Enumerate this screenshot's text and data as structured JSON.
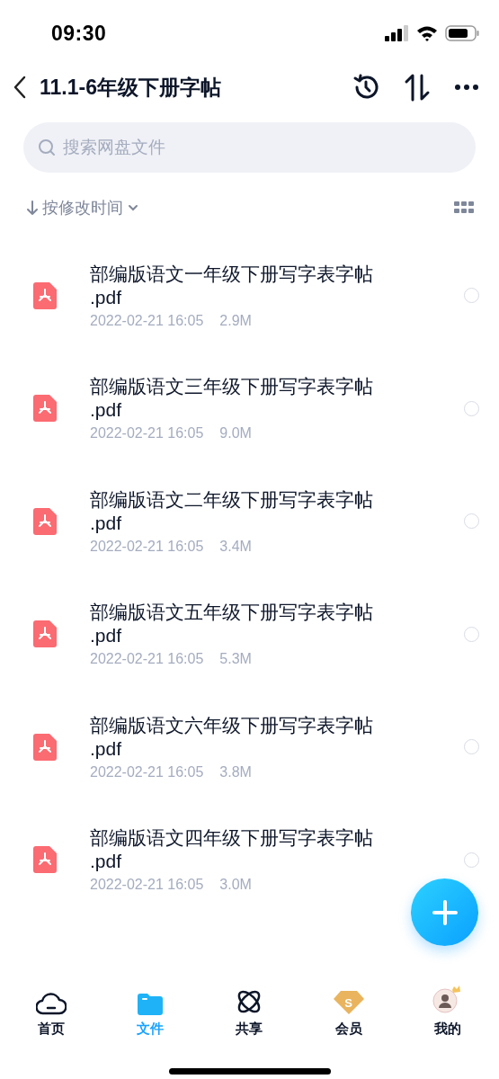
{
  "status_bar": {
    "time": "09:30"
  },
  "header": {
    "title": "11.1-6年级下册字帖"
  },
  "search": {
    "placeholder": "搜索网盘文件"
  },
  "sort": {
    "label": "按修改时间"
  },
  "files": [
    {
      "name": "部编版语文一年级下册写字表字帖.pdf",
      "date": "2022-02-21 16:05",
      "size": "2.9M",
      "selected": false
    },
    {
      "name": "部编版语文三年级下册写字表字帖.pdf",
      "date": "2022-02-21 16:05",
      "size": "9.0M",
      "selected": false
    },
    {
      "name": "部编版语文二年级下册写字表字帖.pdf",
      "date": "2022-02-21 16:05",
      "size": "3.4M",
      "selected": false
    },
    {
      "name": "部编版语文五年级下册写字表字帖.pdf",
      "date": "2022-02-21 16:05",
      "size": "5.3M",
      "selected": false
    },
    {
      "name": "部编版语文六年级下册写字表字帖.pdf",
      "date": "2022-02-21 16:05",
      "size": "3.8M",
      "selected": false
    },
    {
      "name": "部编版语文四年级下册写字表字帖.pdf",
      "date": "2022-02-21 16:05",
      "size": "3.0M",
      "selected": false
    }
  ],
  "tabs": [
    {
      "kind": "home",
      "label": "首页",
      "selected": false
    },
    {
      "kind": "files",
      "label": "文件",
      "selected": true
    },
    {
      "kind": "share",
      "label": "共享",
      "selected": false
    },
    {
      "kind": "vip",
      "label": "会员",
      "selected": false,
      "icon_text": "S"
    },
    {
      "kind": "me",
      "label": "我的",
      "selected": false
    }
  ]
}
